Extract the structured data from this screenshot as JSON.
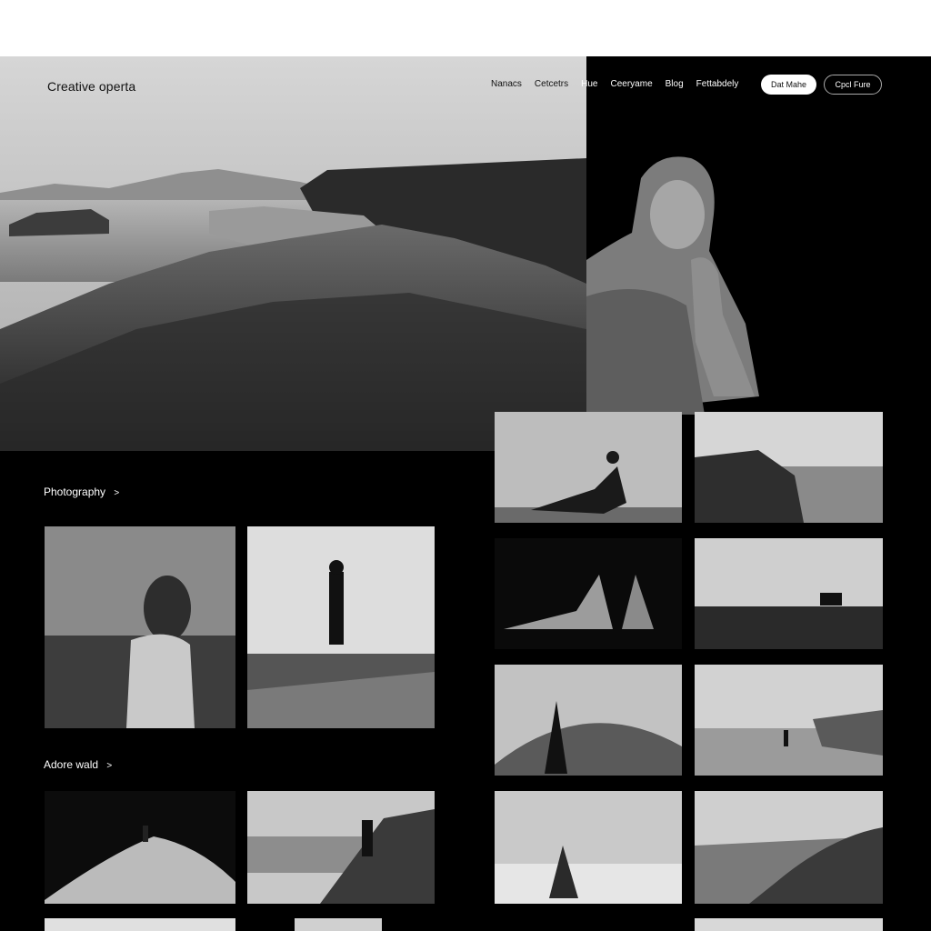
{
  "header": {
    "brand": "Creative operta",
    "nav": [
      "Nanacs",
      "Cetcetrs",
      "Hue",
      "Ceeryame",
      "Blog",
      "Fettabdely"
    ],
    "button_primary": "Dat Mahe",
    "button_secondary": "Cpcl Fure"
  },
  "sections": [
    {
      "title": "Photography",
      "chevron": ">"
    },
    {
      "title": "Adore wald",
      "chevron": ">"
    }
  ],
  "icons": [
    "chevron-right-icon"
  ],
  "colors": {
    "background": "#000000",
    "topband": "#ffffff",
    "text": "#ffffff",
    "brand_text": "#111111"
  }
}
